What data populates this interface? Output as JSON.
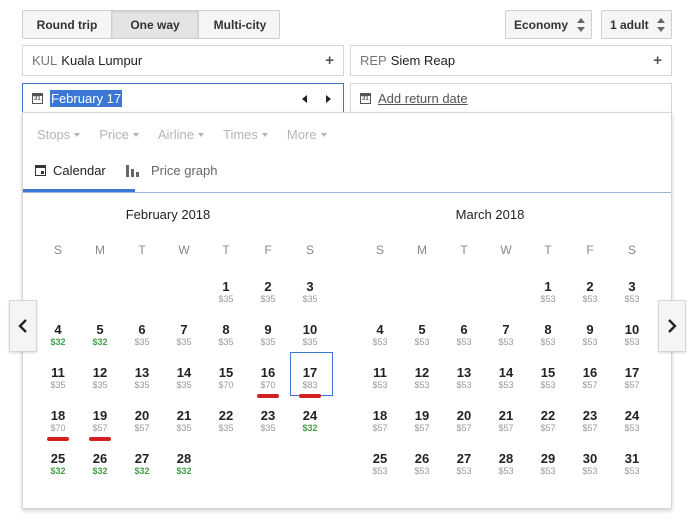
{
  "trip_type": {
    "options": [
      "Round trip",
      "One way",
      "Multi-city"
    ],
    "selected": "One way"
  },
  "cabin": "Economy",
  "passengers": "1 adult",
  "origin": {
    "code": "KUL",
    "city": "Kuala Lumpur"
  },
  "destination": {
    "code": "REP",
    "city": "Siem Reap"
  },
  "depart_date": "February 17",
  "return_placeholder": "Add return date",
  "filters": [
    "Stops",
    "Price",
    "Airline",
    "Times",
    "More"
  ],
  "views": {
    "calendar": "Calendar",
    "price_graph": "Price graph"
  },
  "colors": {
    "accent": "#3d77d6",
    "cheap": "#43a047",
    "marker": "#d32020"
  },
  "weekdays": [
    "S",
    "M",
    "T",
    "W",
    "T",
    "F",
    "S"
  ],
  "selected_day": "17",
  "red_marked_days": [
    "16",
    "17",
    "18",
    "19"
  ],
  "months": [
    {
      "title": "February 2018",
      "weeks": [
        [
          null,
          null,
          null,
          null,
          {
            "d": "1",
            "p": "$35"
          },
          {
            "d": "2",
            "p": "$35"
          },
          {
            "d": "3",
            "p": "$35"
          }
        ],
        [
          {
            "d": "4",
            "p": "$32",
            "low": true
          },
          {
            "d": "5",
            "p": "$32",
            "low": true
          },
          {
            "d": "6",
            "p": "$35"
          },
          {
            "d": "7",
            "p": "$35"
          },
          {
            "d": "8",
            "p": "$35"
          },
          {
            "d": "9",
            "p": "$35"
          },
          {
            "d": "10",
            "p": "$35"
          }
        ],
        [
          {
            "d": "11",
            "p": "$35"
          },
          {
            "d": "12",
            "p": "$35"
          },
          {
            "d": "13",
            "p": "$35"
          },
          {
            "d": "14",
            "p": "$35"
          },
          {
            "d": "15",
            "p": "$70"
          },
          {
            "d": "16",
            "p": "$70"
          },
          {
            "d": "17",
            "p": "$83"
          }
        ],
        [
          {
            "d": "18",
            "p": "$70"
          },
          {
            "d": "19",
            "p": "$57"
          },
          {
            "d": "20",
            "p": "$57"
          },
          {
            "d": "21",
            "p": "$35"
          },
          {
            "d": "22",
            "p": "$35"
          },
          {
            "d": "23",
            "p": "$35"
          },
          {
            "d": "24",
            "p": "$32",
            "low": true
          }
        ],
        [
          {
            "d": "25",
            "p": "$32",
            "low": true
          },
          {
            "d": "26",
            "p": "$32",
            "low": true
          },
          {
            "d": "27",
            "p": "$32",
            "low": true
          },
          {
            "d": "28",
            "p": "$32",
            "low": true
          },
          null,
          null,
          null
        ]
      ]
    },
    {
      "title": "March 2018",
      "weeks": [
        [
          null,
          null,
          null,
          null,
          {
            "d": "1",
            "p": "$53"
          },
          {
            "d": "2",
            "p": "$53"
          },
          {
            "d": "3",
            "p": "$53"
          }
        ],
        [
          {
            "d": "4",
            "p": "$53"
          },
          {
            "d": "5",
            "p": "$53"
          },
          {
            "d": "6",
            "p": "$53"
          },
          {
            "d": "7",
            "p": "$53"
          },
          {
            "d": "8",
            "p": "$53"
          },
          {
            "d": "9",
            "p": "$53"
          },
          {
            "d": "10",
            "p": "$53"
          }
        ],
        [
          {
            "d": "11",
            "p": "$53"
          },
          {
            "d": "12",
            "p": "$53"
          },
          {
            "d": "13",
            "p": "$53"
          },
          {
            "d": "14",
            "p": "$53"
          },
          {
            "d": "15",
            "p": "$53"
          },
          {
            "d": "16",
            "p": "$57"
          },
          {
            "d": "17",
            "p": "$57"
          }
        ],
        [
          {
            "d": "18",
            "p": "$57"
          },
          {
            "d": "19",
            "p": "$57"
          },
          {
            "d": "20",
            "p": "$57"
          },
          {
            "d": "21",
            "p": "$57"
          },
          {
            "d": "22",
            "p": "$57"
          },
          {
            "d": "23",
            "p": "$57"
          },
          {
            "d": "24",
            "p": "$53"
          }
        ],
        [
          {
            "d": "25",
            "p": "$53"
          },
          {
            "d": "26",
            "p": "$53"
          },
          {
            "d": "27",
            "p": "$53"
          },
          {
            "d": "28",
            "p": "$53"
          },
          {
            "d": "29",
            "p": "$53"
          },
          {
            "d": "30",
            "p": "$53"
          },
          {
            "d": "31",
            "p": "$53"
          }
        ]
      ]
    }
  ]
}
